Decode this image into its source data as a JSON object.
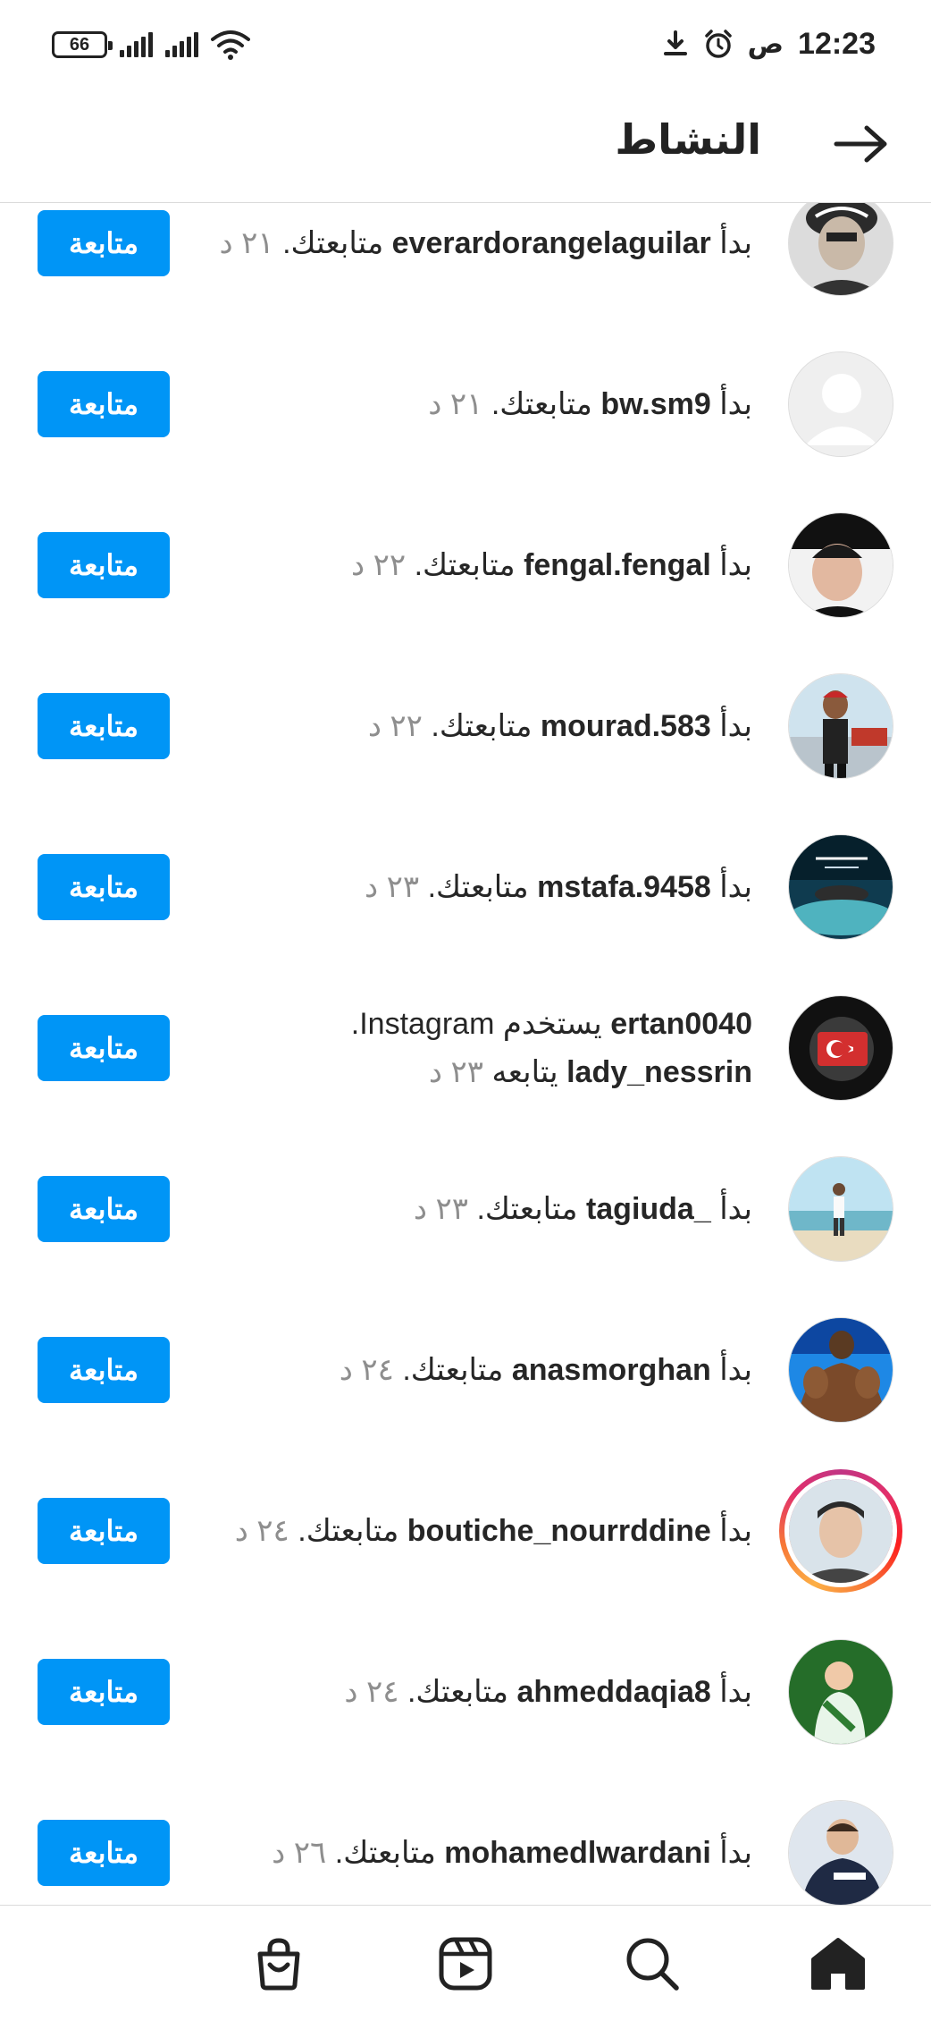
{
  "status_bar": {
    "time": "12:23",
    "ampm": "ص",
    "battery": "66",
    "icons": [
      "download-icon",
      "alarm-icon",
      "wifi-icon",
      "signal-icon"
    ]
  },
  "header": {
    "title": "النشاط",
    "back_icon": "arrow-right-icon"
  },
  "follow_label": "متابعة",
  "rows": [
    {
      "prefix": "بدأ",
      "user": "everardorangelaguilar",
      "action": "متابعتك.",
      "time": "٢١ د"
    },
    {
      "prefix": "بدأ",
      "user": "bw.sm9",
      "action": "متابعتك.",
      "time": "٢١ د"
    },
    {
      "prefix": "بدأ",
      "user": "fengal.fengal",
      "action": "متابعتك.",
      "time": "٢٢ د"
    },
    {
      "prefix": "بدأ",
      "user": "mourad.583",
      "action": "متابعتك.",
      "time": "٢٢ د"
    },
    {
      "prefix": "بدأ",
      "user": "mstafa.9458",
      "action": "متابعتك.",
      "time": "٢٣ د"
    },
    {
      "user": "ertan0040",
      "action": "يستخدم Instagram.",
      "user2": "lady_nessrin",
      "action2": "يتابعه",
      "time": "٢٣ د"
    },
    {
      "prefix": "بدأ",
      "user": "_tagiuda",
      "action": "متابعتك.",
      "time": "٢٣ د"
    },
    {
      "prefix": "بدأ",
      "user": "anasmorghan",
      "action": "متابعتك.",
      "time": "٢٤ د"
    },
    {
      "prefix": "بدأ",
      "user": "boutiche_nourrddine",
      "action": "متابعتك.",
      "time": "٢٤ د"
    },
    {
      "prefix": "بدأ",
      "user": "ahmeddaqia8",
      "action": "متابعتك.",
      "time": "٢٤ د"
    },
    {
      "prefix": "بدأ",
      "user": "mohamedlwardani",
      "action": "متابعتك.",
      "time": "٢٦ د"
    }
  ],
  "bottom_nav": [
    "shop-icon",
    "reels-icon",
    "search-icon",
    "home-icon"
  ],
  "colors": {
    "follow_button": "#0095f6",
    "text": "#262626",
    "secondary_text": "#8e8e8e"
  }
}
